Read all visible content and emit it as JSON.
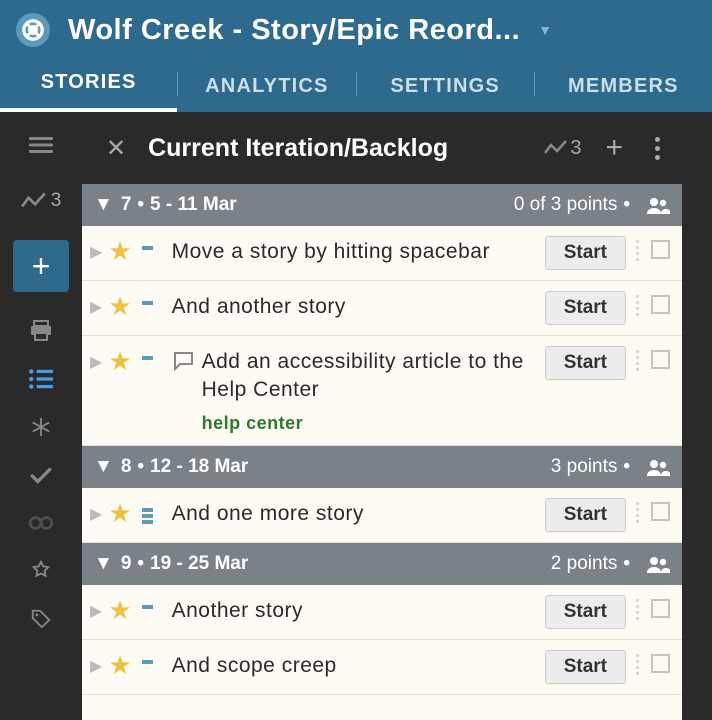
{
  "header": {
    "title": "Wolf Creek - Story/Epic Reord...",
    "tabs": [
      "STORIES",
      "ANALYTICS",
      "SETTINGS",
      "MEMBERS"
    ],
    "active_tab": 0
  },
  "sidebar": {
    "velocity": "3"
  },
  "panel": {
    "title": "Current Iteration/Backlog",
    "velocity": "3"
  },
  "iterations": [
    {
      "num": "7",
      "dates": "5 - 11 Mar",
      "points": "0 of 3 points",
      "stories": [
        {
          "title": "Move a story by hitting spacebar",
          "est_bars": 1,
          "button": "Start"
        },
        {
          "title": "And another story",
          "est_bars": 1,
          "button": "Start"
        },
        {
          "title": "Add an accessibility article to the Help Center",
          "est_bars": 1,
          "has_comment": true,
          "label": "help center",
          "button": "Start"
        }
      ]
    },
    {
      "num": "8",
      "dates": "12 - 18 Mar",
      "points": "3 points",
      "stories": [
        {
          "title": "And one more story",
          "est_bars": 3,
          "button": "Start"
        }
      ]
    },
    {
      "num": "9",
      "dates": "19 - 25 Mar",
      "points": "2 points",
      "stories": [
        {
          "title": "Another story",
          "est_bars": 1,
          "button": "Start"
        },
        {
          "title": "And scope creep",
          "est_bars": 1,
          "button": "Start"
        }
      ]
    }
  ]
}
